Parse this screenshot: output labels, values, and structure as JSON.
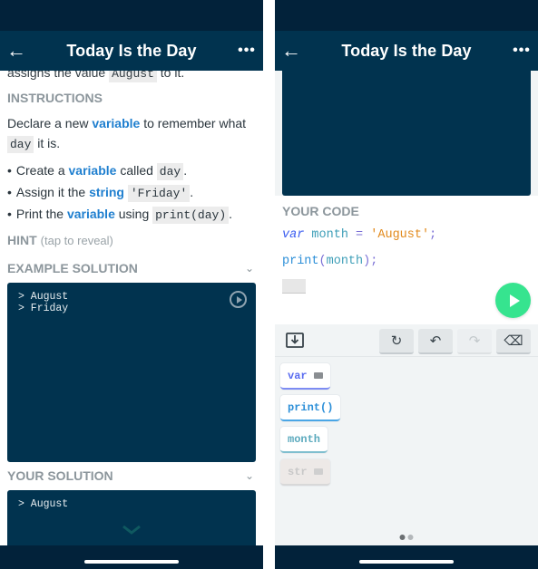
{
  "left": {
    "nav": {
      "title": "Today Is the Day",
      "back_icon": "arrow-left-icon",
      "more_icon": "ellipsis-icon"
    },
    "clipped_text": {
      "before": "assigns the value ",
      "code": "August",
      "after": " to it."
    },
    "instructions": {
      "heading": "INSTRUCTIONS",
      "intro": {
        "t1": "Declare a new ",
        "kw": "variable",
        "t2": " to remember what ",
        "code": "day",
        "t3": " it is."
      },
      "bullets": [
        {
          "t1": "Create a ",
          "kw": "variable",
          "t2": " called ",
          "code": "day",
          "t3": "."
        },
        {
          "t1": "Assign it the ",
          "kw": "string",
          "t2": " ",
          "code": "'Friday'",
          "t3": "."
        },
        {
          "t1": "Print the ",
          "kw": "variable",
          "t2": " using ",
          "code": "print(day)",
          "t3": "."
        }
      ]
    },
    "hint": {
      "label": "HINT",
      "note": "(tap to reveal)"
    },
    "example_solution": {
      "heading": "EXAMPLE SOLUTION",
      "output_lines": [
        "> August",
        "> Friday"
      ]
    },
    "your_solution": {
      "heading": "YOUR SOLUTION",
      "output_lines": [
        "> August"
      ]
    }
  },
  "right": {
    "nav": {
      "title": "Today Is the Day",
      "back_icon": "arrow-left-icon",
      "more_icon": "ellipsis-icon"
    },
    "code": {
      "heading": "YOUR CODE",
      "line1": {
        "kw": "var",
        "id": "month",
        "op": "=",
        "str": "'August'",
        "end": ";"
      },
      "line2": {
        "fn": "print",
        "open": "(",
        "arg": "month",
        "close": ")",
        "end": ";"
      }
    },
    "toolbar": {
      "insert_icon": "insert-line-icon",
      "buttons": [
        {
          "icon": "refresh-icon",
          "glyph": "↻",
          "enabled": true
        },
        {
          "icon": "undo-icon",
          "glyph": "↶",
          "enabled": true
        },
        {
          "icon": "redo-icon",
          "glyph": "↷",
          "enabled": false
        },
        {
          "icon": "backspace-icon",
          "glyph": "⌫",
          "enabled": true
        }
      ]
    },
    "tokens": [
      {
        "label": "var",
        "keyboard": true,
        "color": "#5a6cf0",
        "underline": "#7d8cf3",
        "enabled": true
      },
      {
        "label": "print()",
        "keyboard": false,
        "color": "#2c8fd8",
        "underline": "#4aa6e6",
        "enabled": true
      },
      {
        "label": "month",
        "keyboard": false,
        "color": "#5aa9bd",
        "underline": "#7fbfcf",
        "enabled": true
      },
      {
        "label": "str",
        "keyboard": true,
        "color": "#c8c8c8",
        "underline": "#d8d8d8",
        "enabled": false
      }
    ],
    "pager": {
      "pages": 2,
      "active": 1
    }
  },
  "colors": {
    "nav_bg": "#01334f",
    "status_bg": "#02223a",
    "keyword": "#1f7fcf",
    "run_button": "#36e48f"
  }
}
